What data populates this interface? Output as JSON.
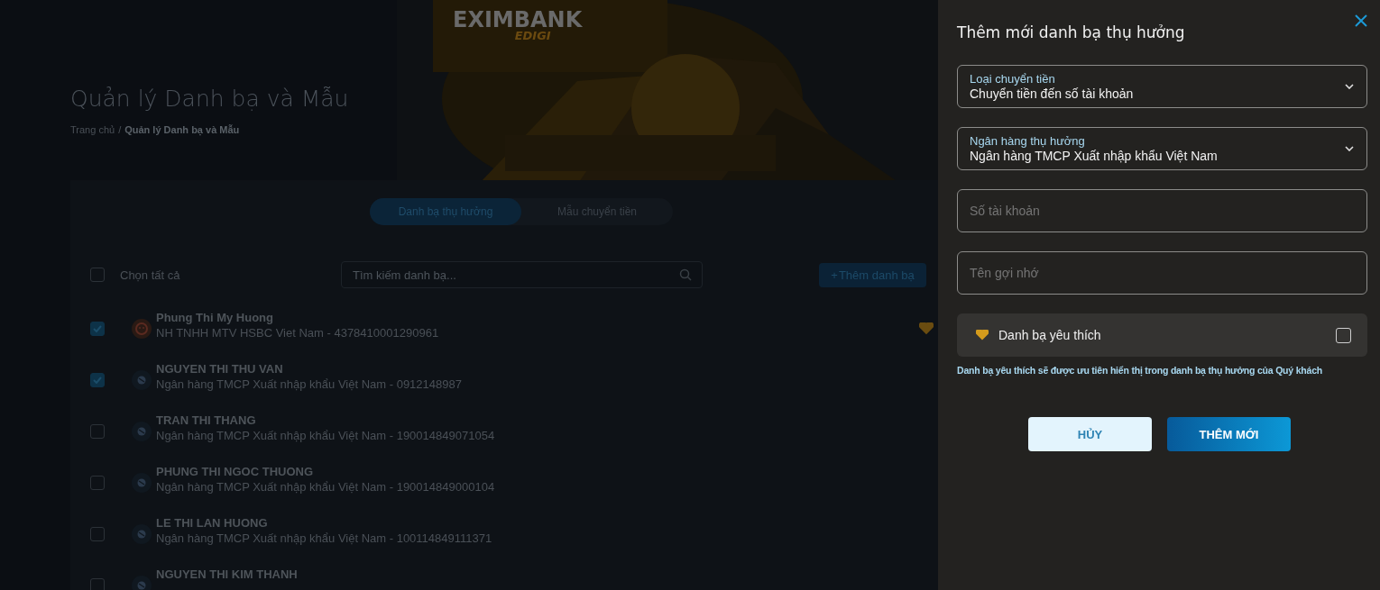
{
  "background_page": {
    "logo": {
      "name": "EXIMBANK",
      "sub": "EDIGI"
    },
    "title": "Quản lý Danh bạ và Mẫu",
    "breadcrumb_separator": "/",
    "breadcrumb": [
      {
        "label": "Trang chủ",
        "current": false
      },
      {
        "label": "Quản lý Danh bạ và Mẫu",
        "current": true
      }
    ],
    "tabs": [
      {
        "label": "Danh bạ thụ hưởng",
        "selected": true
      },
      {
        "label": "Mẫu chuyển tiền",
        "selected": false
      }
    ],
    "select_all": {
      "label": "Chọn tất cả",
      "checked": false
    },
    "search": {
      "placeholder": "Tìm kiếm danh bạ..."
    },
    "add_button": {
      "icon": "+",
      "label": "Thêm danh bạ"
    },
    "contacts": [
      {
        "name": "Phung Thi My Huong",
        "detail": "NH TNHH MTV HSBC Viet Nam - 4378410001290961",
        "checked": true,
        "favorite": true,
        "kind": "other"
      },
      {
        "name": "NGUYEN THI THU VAN",
        "detail": "Ngân hàng TMCP Xuất nhập khẩu Việt Nam - 0912148987",
        "checked": true,
        "favorite": false,
        "kind": "bank"
      },
      {
        "name": "TRAN THI THANG",
        "detail": "Ngân hàng TMCP Xuất nhập khẩu Việt Nam - 190014849071054",
        "checked": false,
        "favorite": false,
        "kind": "bank"
      },
      {
        "name": "PHUNG THI NGOC THUONG",
        "detail": "Ngân hàng TMCP Xuất nhập khẩu Việt Nam - 190014849000104",
        "checked": false,
        "favorite": false,
        "kind": "bank"
      },
      {
        "name": "LE THI LAN HUONG",
        "detail": "Ngân hàng TMCP Xuất nhập khẩu Việt Nam - 100114849111371",
        "checked": false,
        "favorite": false,
        "kind": "bank"
      },
      {
        "name": "NGUYEN THI KIM THANH",
        "checked": false,
        "favorite": false,
        "kind": "bank"
      }
    ]
  },
  "panel": {
    "title": "Thêm mới danh bạ thụ hưởng",
    "fields": [
      {
        "kind": "select",
        "label": "Loại chuyển tiền",
        "value": "Chuyển tiền đến số tài khoản"
      },
      {
        "kind": "select",
        "label": "Ngân hàng thụ hưởng",
        "value": "Ngân hàng TMCP Xuất nhập khẩu Việt Nam"
      },
      {
        "kind": "input",
        "placeholder": "Số tài khoản"
      },
      {
        "kind": "input",
        "placeholder": "Tên gợi nhớ"
      }
    ],
    "favorite": {
      "label": "Danh bạ yêu thích",
      "checked": false
    },
    "hint": "Danh bạ yêu thích sẽ được ưu tiên hiển thị trong danh bạ thụ hưởng của Quý khách",
    "buttons": [
      {
        "kind": "secondary",
        "label": "HỦY"
      },
      {
        "kind": "primary",
        "label": "THÊM MỚI"
      }
    ]
  }
}
